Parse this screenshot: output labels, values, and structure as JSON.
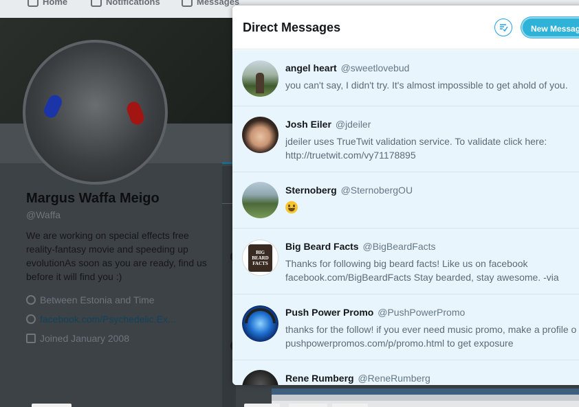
{
  "nav": {
    "items": [
      {
        "label": "Home",
        "icon": "home-icon"
      },
      {
        "label": "Notifications",
        "icon": "bell-icon"
      },
      {
        "label": "Messages",
        "icon": "envelope-icon"
      }
    ]
  },
  "profile": {
    "name": "Margus Waffa Meigo",
    "handle": "@Waffa",
    "bio": "We are working on special effects free reality-fantasy movie and speeding up evolutionAs soon as you are ready, find us before it will find you :)",
    "location": "Between Estonia and Time",
    "website": "facebook.com/Psychedelic.Ex...",
    "joined": "Joined January 2008"
  },
  "modal": {
    "title": "Direct Messages",
    "new_message_label": "New Message",
    "mark_all_read_icon": "mark-all-read-icon"
  },
  "conversations": [
    {
      "name": "angel heart",
      "handle": "@sweetlovebud",
      "lines": [
        "you can't say, I didn't try. It's almost impossible to get ahold of you."
      ]
    },
    {
      "name": "Josh Eiler",
      "handle": "@jdeiler",
      "lines": [
        "jdeiler uses TrueTwit validation service. To validate click here:",
        "http://truetwit.com/vy71178895"
      ]
    },
    {
      "name": "Sternoberg",
      "handle": "@SternobergOU",
      "lines": [],
      "emoji": "smiling-face-emoji"
    },
    {
      "name": "Big Beard Facts",
      "handle": "@BigBeardFacts",
      "lines": [
        "Thanks for following big beard facts! Like us on facebook",
        "facebook.com/BigBeardFacts Stay bearded, stay awesome. -via"
      ],
      "avatar_text": "BIG BEARD FACTS"
    },
    {
      "name": "Push Power Promo",
      "handle": "@PushPowerPromo",
      "lines": [
        "thanks for the follow! if you ever need music promo, make a profile o",
        "pushpowerpromos.com/p/promo.html to get exposure"
      ]
    },
    {
      "name": "Rene Rumberg",
      "handle": "@ReneRumberg",
      "lines": []
    }
  ],
  "colors": {
    "accent": "#1da1f2",
    "new_message_button": "#2fb2d8",
    "unread_row_bg": "#e8f5fd",
    "overlay": "#3d4247"
  }
}
